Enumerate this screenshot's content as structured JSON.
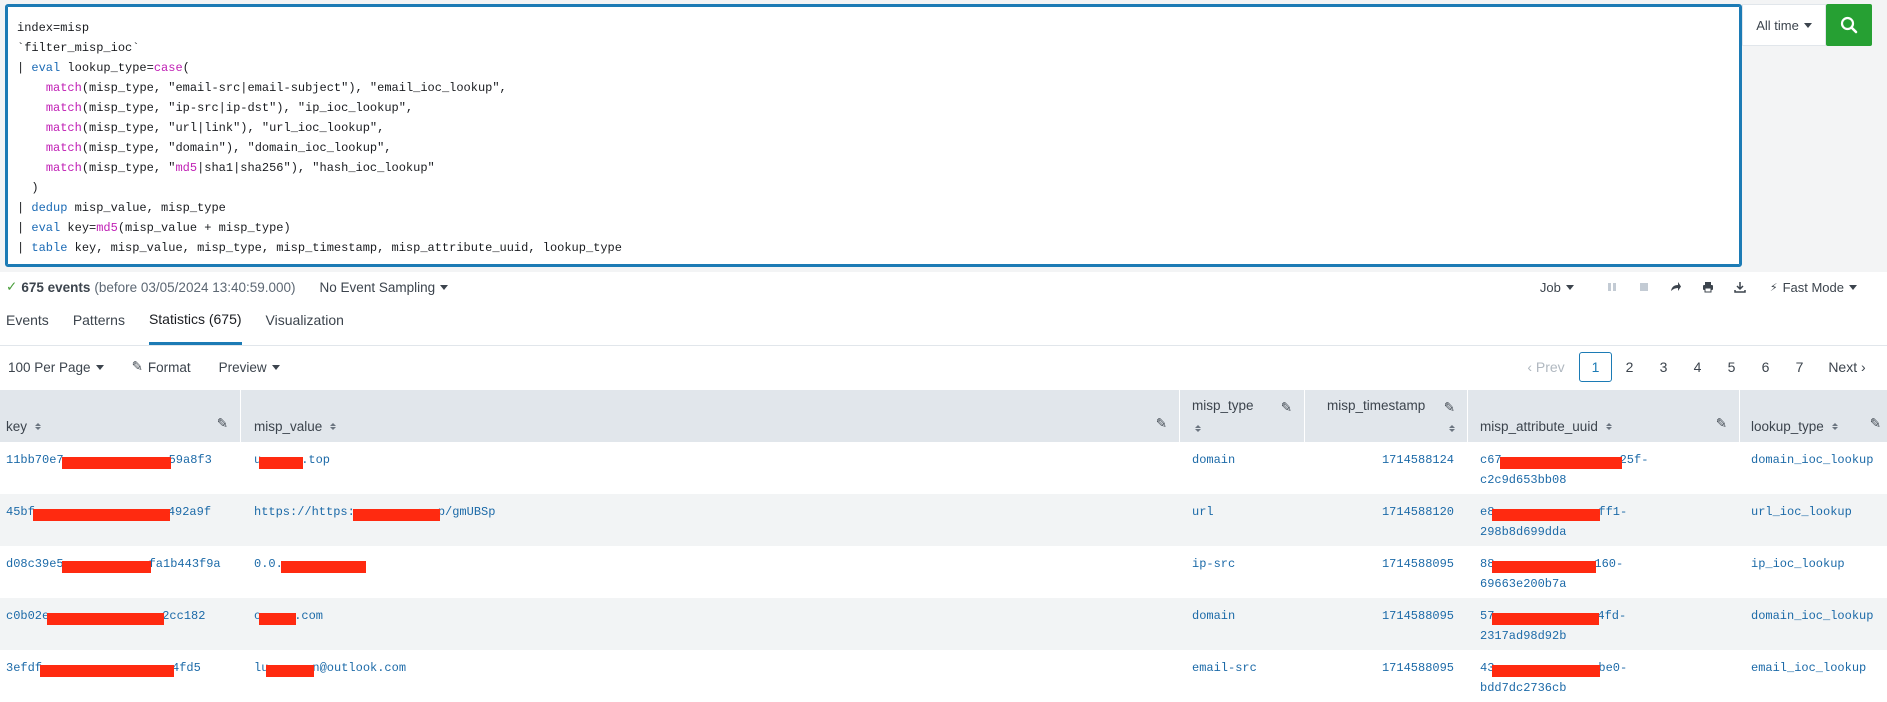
{
  "search": {
    "query_lines": [
      "index=misp",
      "`filter_misp_ioc`",
      "| eval lookup_type=case(",
      "    match(misp_type, \"email-src|email-subject\"), \"email_ioc_lookup\",",
      "    match(misp_type, \"ip-src|ip-dst\"), \"ip_ioc_lookup\",",
      "    match(misp_type, \"url|link\"), \"url_ioc_lookup\",",
      "    match(misp_type, \"domain\"), \"domain_ioc_lookup\",",
      "    match(misp_type, \"md5|sha1|sha256\"), \"hash_ioc_lookup\"",
      "  )",
      "| dedup misp_value, misp_type",
      "| eval key=md5(misp_value + misp_type)",
      "| table key, misp_value, misp_type, misp_timestamp, misp_attribute_uuid, lookup_type"
    ],
    "time_range": "All time",
    "search_icon": "search-icon"
  },
  "status": {
    "events_count": "675 events",
    "events_before": "(before 03/05/2024 13:40:59.000)",
    "sampling": "No Event Sampling",
    "job": "Job",
    "mode": "Fast Mode"
  },
  "tabs": [
    "Events",
    "Patterns",
    "Statistics (675)",
    "Visualization"
  ],
  "toolbar": {
    "per_page": "100 Per Page",
    "format": "Format",
    "preview": "Preview"
  },
  "pager": {
    "prev": "Prev",
    "pages": [
      "1",
      "2",
      "3",
      "4",
      "5",
      "6",
      "7"
    ],
    "next": "Next"
  },
  "table": {
    "columns": [
      "key",
      "misp_value",
      "misp_type",
      "misp_timestamp",
      "misp_attribute_uuid",
      "lookup_type"
    ],
    "rows": [
      {
        "key": "11bb70e7",
        "key_tail": "59a8f3",
        "value": "u",
        "value_tail": ".top",
        "type": "domain",
        "ts": "1714588124",
        "uuid1": "c67",
        "uuid1_tail": "25f-",
        "uuid2": "c2c9d653bb08",
        "lookup": "domain_ioc_lookup"
      },
      {
        "key": "45bf",
        "key_tail": "492a9f",
        "value": "https://https:",
        "value_tail": "p/gmUBSp",
        "type": "url",
        "ts": "1714588120",
        "uuid1": "e8",
        "uuid1_tail": "ff1-",
        "uuid2": "298b8d699dda",
        "lookup": "url_ioc_lookup"
      },
      {
        "key": "d08c39e5",
        "key_tail": "fa1b443f9a",
        "value": "0.0.",
        "value_tail": "",
        "type": "ip-src",
        "ts": "1714588095",
        "uuid1": "88",
        "uuid1_tail": "160-",
        "uuid2": "69663e200b7a",
        "lookup": "ip_ioc_lookup"
      },
      {
        "key": "c0b02e",
        "key_tail": "2cc182",
        "value": "o",
        "value_tail": ".com",
        "type": "domain",
        "ts": "1714588095",
        "uuid1": "57",
        "uuid1_tail": "4fd-",
        "uuid2": "2317ad98d92b",
        "lookup": "domain_ioc_lookup"
      },
      {
        "key": "3efdf",
        "key_tail": "4fd5",
        "value": "lu",
        "value_tail": "n@outlook.com",
        "type": "email-src",
        "ts": "1714588095",
        "uuid1": "43",
        "uuid1_tail": "be0-",
        "uuid2": "bdd7dc2736cb",
        "lookup": "email_ioc_lookup"
      }
    ]
  },
  "colors": {
    "accent": "#1c7bb5",
    "search_button": "#26a033",
    "redaction": "#ff2a10"
  }
}
